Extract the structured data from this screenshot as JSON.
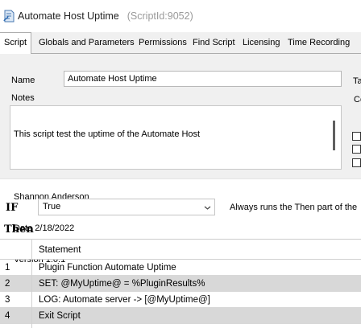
{
  "window": {
    "title": "Automate Host Uptime",
    "script_id": "(ScriptId:9052)"
  },
  "tabs": [
    {
      "label": "Script",
      "active": true
    },
    {
      "label": "Globals and Parameters"
    },
    {
      "label": "Permissions"
    },
    {
      "label": "Find Script"
    },
    {
      "label": "Licensing"
    },
    {
      "label": "Time Recording"
    }
  ],
  "form": {
    "name_label": "Name",
    "name_value": "Automate Host Uptime",
    "notes_label": "Notes",
    "notes_lines": [
      "This script test the uptime of the Automate Host",
      "",
      "Shannon Anderson",
      "Date 2/18/2022",
      "Version 1.0.1"
    ],
    "right_label_partial": "Ta",
    "right_field_partial": "Co"
  },
  "logic": {
    "if_label": "IF",
    "condition_value": "True",
    "condition_note": "Always runs the Then part of the",
    "then_label": "Then"
  },
  "grid": {
    "header": "Statement",
    "rows": [
      {
        "num": "1",
        "statement": "Plugin Function Automate Uptime"
      },
      {
        "num": "2",
        "statement": "SET:  @MyUptime@ = %PluginResults%"
      },
      {
        "num": "3",
        "statement": "LOG:  Automate server -> [@MyUptime@]"
      },
      {
        "num": "4",
        "statement": "Exit Script"
      }
    ]
  },
  "colors": {
    "panel_bg": "#f0f0f0",
    "row_highlight": "#d8d8d8"
  }
}
